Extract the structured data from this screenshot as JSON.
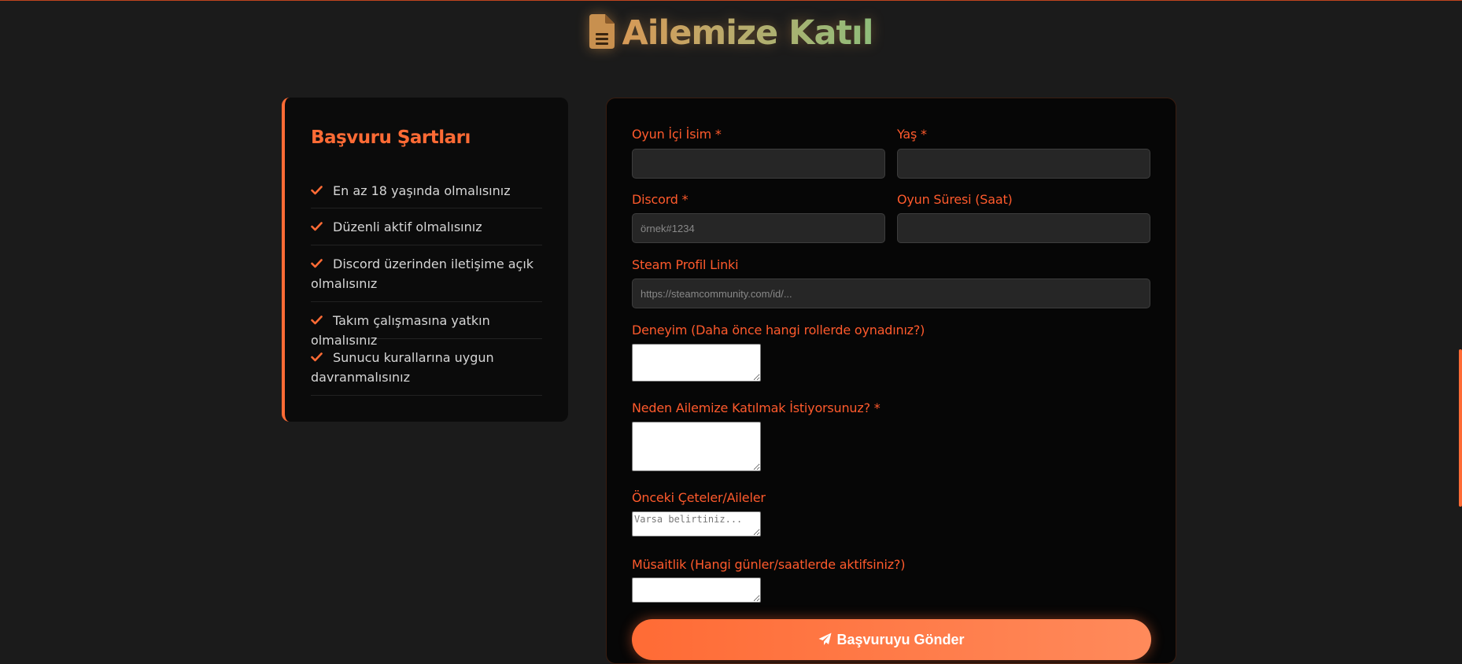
{
  "header": {
    "title": "Ailemize Katıl",
    "icon": "file-document-icon"
  },
  "colors": {
    "accent": "#ff6b35",
    "background": "#1b1b1b",
    "card": "#0b0b0b"
  },
  "requirements": {
    "title": "Başvuru Şartları",
    "items": [
      "En az 18 yaşında olmalısınız",
      "Düzenli aktif olmalısınız",
      "Discord üzerinden iletişime açık olmalısınız",
      "Takım çalışmasına yatkın olmalısınız",
      "Sunucu kurallarına uygun davranmalısınız"
    ]
  },
  "form": {
    "ingame_name": {
      "label": "Oyun İçi İsim *",
      "value": "",
      "placeholder": ""
    },
    "age": {
      "label": "Yaş *",
      "value": "",
      "placeholder": ""
    },
    "discord": {
      "label": "Discord *",
      "value": "",
      "placeholder": "örnek#1234"
    },
    "playtime": {
      "label": "Oyun Süresi (Saat)",
      "value": "",
      "placeholder": ""
    },
    "steam": {
      "label": "Steam Profil Linki",
      "value": "",
      "placeholder": "https://steamcommunity.com/id/..."
    },
    "experience": {
      "label": "Deneyim (Daha önce hangi rollerde oynadınız?)",
      "placeholder": ""
    },
    "reason": {
      "label": "Neden Ailemize Katılmak İstiyorsunuz? *",
      "placeholder": ""
    },
    "previous": {
      "label": "Önceki Çeteler/Aileler",
      "placeholder": "Varsa belirtiniz..."
    },
    "availability": {
      "label": "Müsaitlik (Hangi günler/saatlerde aktifsiniz?)",
      "placeholder": ""
    },
    "submit_label": "Başvuruyu Gönder",
    "submit_icon": "paper-plane-icon"
  }
}
